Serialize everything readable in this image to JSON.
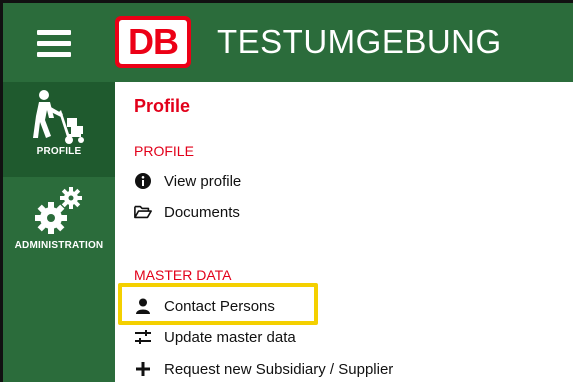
{
  "header": {
    "logo_text": "DB",
    "title": "TESTUMGEBUNG"
  },
  "sidebar": {
    "items": [
      {
        "label": "PROFILE",
        "icon": "worker-cart-icon",
        "active": true
      },
      {
        "label": "ADMINISTRATION",
        "icon": "gears-icon",
        "active": false
      }
    ]
  },
  "main": {
    "page_title": "Profile",
    "sections": [
      {
        "title": "PROFILE",
        "links": [
          {
            "label": "View profile",
            "icon": "info-circle-icon"
          },
          {
            "label": "Documents",
            "icon": "folder-open-icon"
          }
        ]
      },
      {
        "title": "MASTER DATA",
        "links": [
          {
            "label": "Contact Persons",
            "icon": "person-icon"
          },
          {
            "label": "Update master data",
            "icon": "sliders-icon"
          },
          {
            "label": "Request new Subsidiary / Supplier",
            "icon": "plus-icon"
          }
        ]
      }
    ]
  },
  "colors": {
    "brand_green": "#2b6c3b",
    "db_red": "#ec0016",
    "section_red": "#e2001a",
    "highlight_yellow": "#f4d000"
  }
}
